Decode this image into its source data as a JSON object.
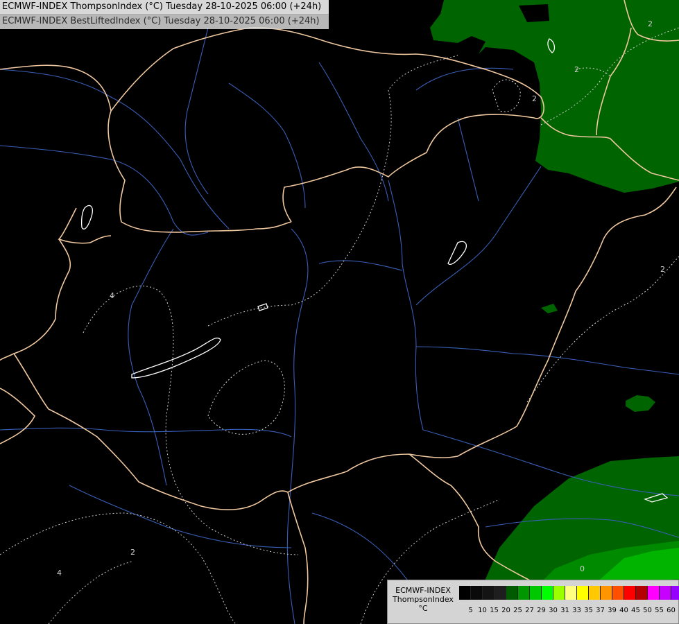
{
  "header": {
    "title_line1": "ECMWF-INDEX ThompsonIndex (°C) Tuesday 28-10-2025 06:00 (+24h)",
    "title_line2": "ECMWF-INDEX BestLiftedIndex (°C) Tuesday 28-10-2025 06:00 (+24h)"
  },
  "legend": {
    "line1": "ECMWF-INDEX",
    "line2": "ThompsonIndex",
    "line3": "°C",
    "colors": [
      "#000000",
      "#0a0a0a",
      "#141414",
      "#1e1e1e",
      "#005a00",
      "#009600",
      "#00c800",
      "#00ff00",
      "#9bff00",
      "#ffff80",
      "#ffff00",
      "#ffc800",
      "#ff9600",
      "#ff5000",
      "#ff0000",
      "#b40000",
      "#ff00ff",
      "#c800ff",
      "#9600ff",
      "#6400ff",
      "#0000ff"
    ],
    "ticks": [
      "5",
      "10",
      "15",
      "20",
      "25",
      "27",
      "29",
      "30",
      "31",
      "33",
      "35",
      "37",
      "39",
      "40",
      "45",
      "50",
      "55",
      "60"
    ]
  },
  "map": {
    "contour_labels": [
      "2",
      "2",
      "2",
      "2",
      "4",
      "2",
      "4",
      "0"
    ],
    "colors": {
      "background": "#000000",
      "border": "#f0c8a0",
      "river": "#3a5fb8",
      "contour": "#d0d0d0",
      "zone_dark": "#005a00",
      "zone_mid": "#007800",
      "zone_bright": "#00b400",
      "lake_outline": "#ffffff"
    }
  }
}
